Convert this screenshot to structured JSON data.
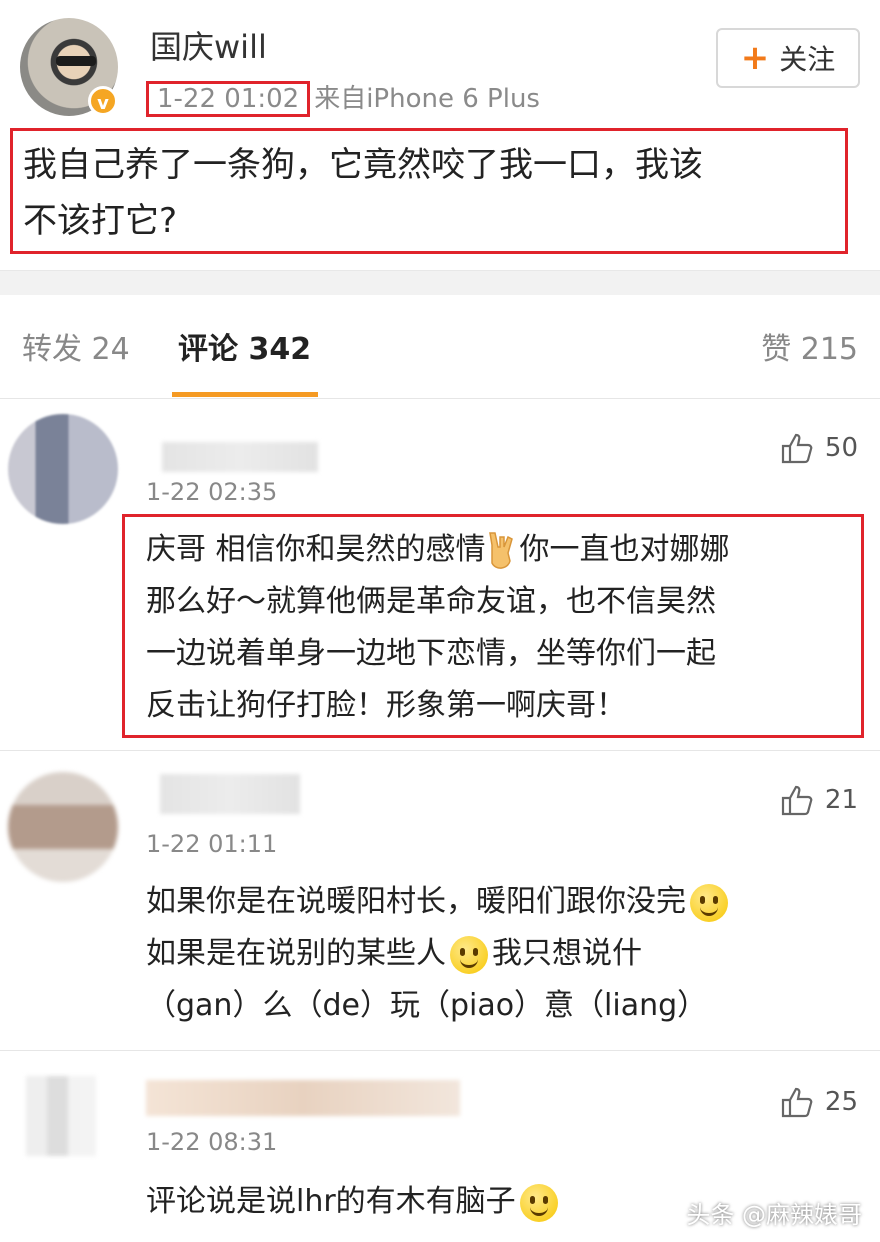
{
  "post": {
    "username": "国庆will",
    "time": "1-22 01:02",
    "source": "来自iPhone 6 Plus",
    "follow_label": "关注",
    "follow_plus": "+",
    "text_line1": "我自己养了一条狗，它竟然咬了我一口，我该",
    "text_line2": "不该打它?"
  },
  "tabs": {
    "repost": "转发 24",
    "comments": "评论 342",
    "likes": "赞 215"
  },
  "comments": [
    {
      "time": "1-22 02:35",
      "likes": "50",
      "lines": [
        "庆哥 相信你和昊然的感情",
        "你一直也对娜娜",
        "那么好～就算他俩是革命友谊，也不信昊然",
        "一边说着单身一边地下恋情，坐等你们一起",
        "反击让狗仔打脸！形象第一啊庆哥！"
      ]
    },
    {
      "time": "1-22 01:11",
      "likes": "21",
      "lines": [
        "如果你是在说暖阳村长，暖阳们跟你没完",
        "如果是在说别的某些人",
        "我只想说什",
        "（gan）么（de）玩（piao）意（liang）"
      ]
    },
    {
      "time": "1-22 08:31",
      "likes": "25",
      "lines": [
        "评论说是说lhr的有木有脑子"
      ]
    }
  ],
  "watermark": "头条 @麻辣婊哥",
  "colors": {
    "highlight_box": "#e0232b",
    "tab_accent": "#f59a23",
    "follow_plus": "#f27a1a",
    "verified": "#f5a623"
  }
}
